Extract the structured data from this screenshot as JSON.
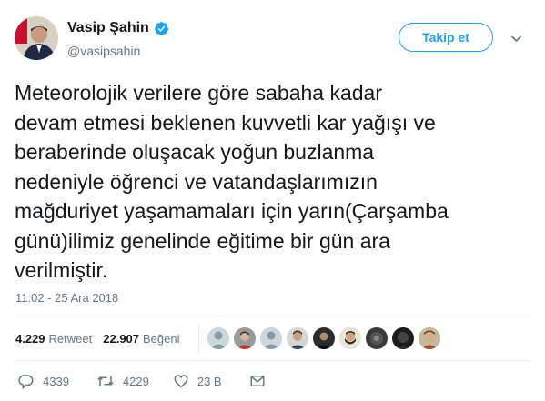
{
  "author": {
    "display_name": "Vasip Şahin",
    "handle": "@vasipsahin",
    "verified_icon": "verified-badge-icon"
  },
  "follow": {
    "label": "Takip et"
  },
  "tweet": {
    "lines": [
      "Meteorolojik verilere göre sabaha kadar",
      "devam etmesi beklenen kuvvetli kar yağışı ve",
      "beraberinde oluşacak yoğun buzlanma",
      "nedeniyle öğrenci ve vatandaşlarımızın",
      "mağduriyet yaşamamaları için yarın(Çarşamba",
      "günü)ilimiz genelinde eğitime bir gün ara",
      "verilmiştir."
    ],
    "timestamp": "11:02 - 25 Ara 2018"
  },
  "stats": {
    "retweets_count": "4.229",
    "retweets_label": "Retweet",
    "likes_count": "22.907",
    "likes_label": "Beğeni"
  },
  "actions": {
    "reply_count": "4339",
    "retweet_count": "4229",
    "like_count": "23 B"
  },
  "colors": {
    "accent": "#1da1f2",
    "muted": "#657786",
    "text": "#14171a",
    "divider": "#e6ecf0"
  }
}
